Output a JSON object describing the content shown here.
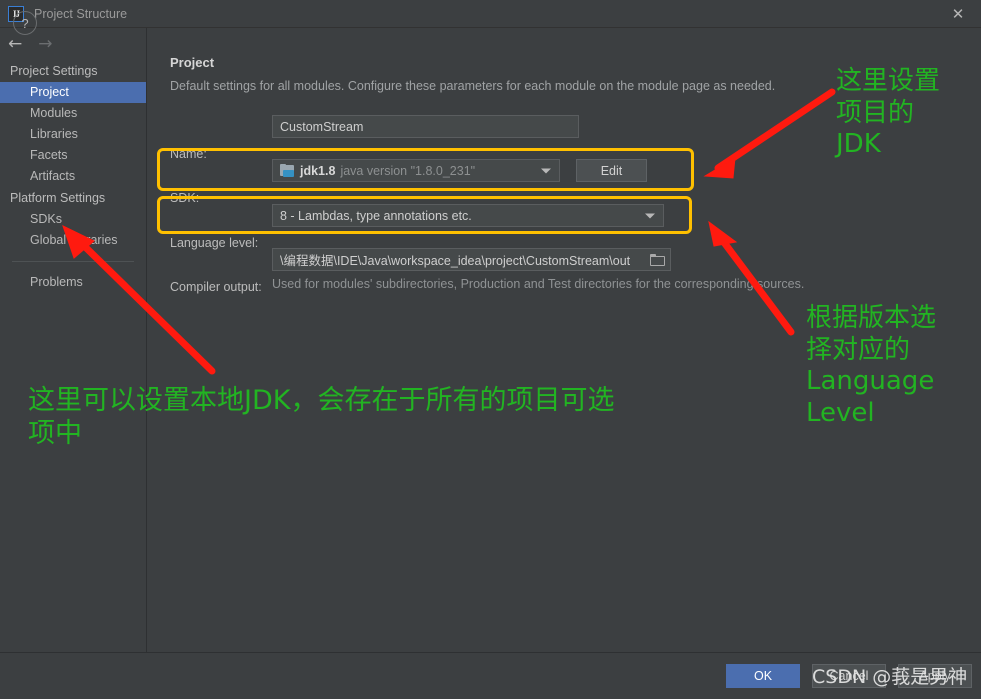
{
  "window": {
    "title": "Project Structure",
    "logo_icon": "intellij-idea-logo",
    "close_icon": "close-icon"
  },
  "nav": {
    "back_icon": "arrow-left-icon",
    "forward_icon": "arrow-right-icon"
  },
  "sidebar": {
    "groups": [
      {
        "label": "Project Settings",
        "items": [
          {
            "label": "Project",
            "selected": true
          },
          {
            "label": "Modules",
            "selected": false
          },
          {
            "label": "Libraries",
            "selected": false
          },
          {
            "label": "Facets",
            "selected": false
          },
          {
            "label": "Artifacts",
            "selected": false
          }
        ]
      },
      {
        "label": "Platform Settings",
        "items": [
          {
            "label": "SDKs",
            "selected": false
          },
          {
            "label": "Global Libraries",
            "selected": false
          }
        ]
      }
    ],
    "problems": "Problems"
  },
  "main": {
    "title": "Project",
    "description": "Default settings for all modules. Configure these parameters for each module on the module page as needed.",
    "name_label": "Name:",
    "name_value": "CustomStream",
    "sdk_label": "SDK:",
    "sdk_icon": "sdk-folder-icon",
    "sdk_name": "jdk1.8",
    "sdk_version": "java version \"1.8.0_231\"",
    "sdk_dropdown_icon": "chevron-down-icon",
    "edit_label": "Edit",
    "language_level_label": "Language level:",
    "language_level_value": "8 - Lambdas, type annotations etc.",
    "language_level_dropdown_icon": "chevron-down-icon",
    "compiler_output_label": "Compiler output:",
    "compiler_output_value": "\\编程数据\\IDE\\Java\\workspace_idea\\project\\CustomStream\\out",
    "compiler_browse_icon": "folder-browse-icon",
    "compiler_hint": "Used for modules' subdirectories, Production and Test directories for the corresponding sources."
  },
  "annotations": {
    "accent_yellow": "#ffc000",
    "accent_red": "#ff1a0f",
    "accent_green": "#22b422",
    "top_right": "这里设置\n项目的\nJDK",
    "top_right_lines": [
      "这里设置",
      "项目的",
      "JDK"
    ],
    "bottom_right_lines": [
      "根据版本选",
      "择对应的",
      "Language",
      "Level"
    ],
    "bottom_left_lines": [
      "这里可以设置本地JDK，会存在于所有的项目可选",
      "项中"
    ]
  },
  "footer": {
    "help_icon": "help-question-icon",
    "ok_label": "OK",
    "cancel_label": "Cancel",
    "apply_label": "Apply",
    "watermark": "CSDN @莪是男神"
  }
}
